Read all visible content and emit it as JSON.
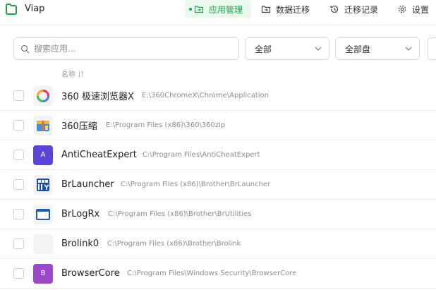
{
  "app": {
    "title": "Viap",
    "accent": "#1aa14a"
  },
  "tabs": [
    {
      "label": "应用管理",
      "icon": "folder-move-icon",
      "active": true
    },
    {
      "label": "数据迁移",
      "icon": "folder-transfer-icon",
      "active": false
    },
    {
      "label": "迁移记录",
      "icon": "history-icon",
      "active": false
    },
    {
      "label": "设置",
      "icon": "gear-icon",
      "active": false
    }
  ],
  "filters": {
    "search_placeholder": "搜索应用...",
    "category": "全部",
    "disk": "全部盘"
  },
  "table": {
    "name_header": "名称",
    "rows": [
      {
        "name": "360 极速浏览器X",
        "path": "E:\\360ChromeX\\Chrome\\Application",
        "icon": "360-browser-icon"
      },
      {
        "name": "360压缩",
        "path": "E:\\Program Files (x86)\\360\\360zip",
        "icon": "360-zip-icon"
      },
      {
        "name": "AntiCheatExpert",
        "path": "C:\\Program Files\\AntiCheatExpert",
        "icon": "letter-a-icon",
        "letter": "A",
        "color": "#5b45d6"
      },
      {
        "name": "BrLauncher",
        "path": "C:\\Program Files (x86)\\Brother\\BrLauncher",
        "icon": "brlauncher-icon"
      },
      {
        "name": "BrLogRx",
        "path": "C:\\Program Files (x86)\\Brother\\BrUtilities",
        "icon": "window-icon"
      },
      {
        "name": "Brolink0",
        "path": "C:\\Program Files (x86)\\Brother\\Brolink",
        "icon": "blank-icon"
      },
      {
        "name": "BrowserCore",
        "path": "C:\\Program Files\\Windows Security\\BrowserCore",
        "icon": "letter-b-icon",
        "letter": "B",
        "color": "#9b49c9"
      }
    ]
  }
}
